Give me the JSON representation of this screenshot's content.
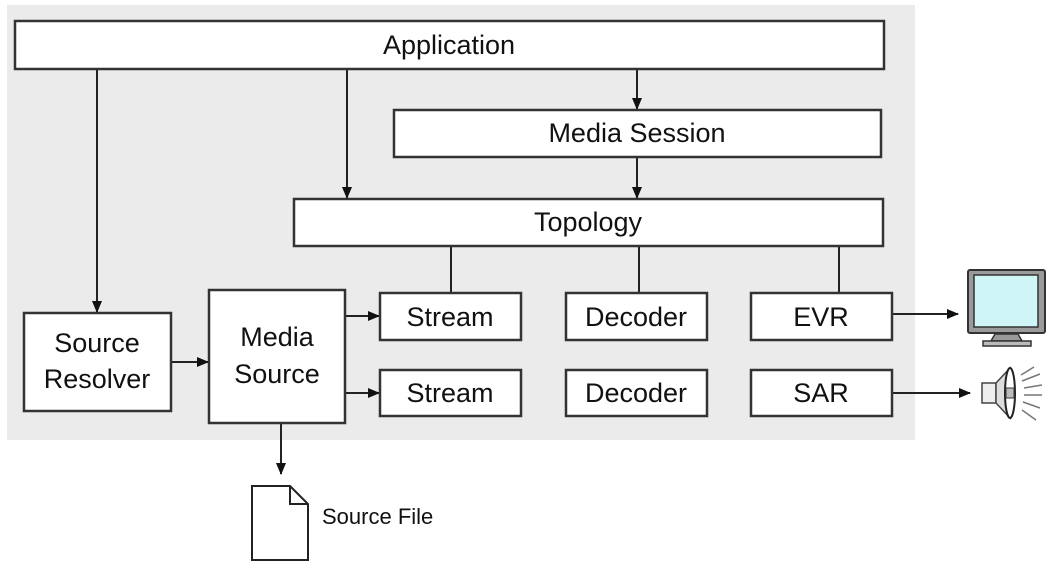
{
  "nodes": {
    "application": "Application",
    "media_session": "Media Session",
    "topology": "Topology",
    "source_resolver": [
      "Source",
      "Resolver"
    ],
    "media_source": [
      "Media",
      "Source"
    ],
    "stream_1": "Stream",
    "stream_2": "Stream",
    "decoder_1": "Decoder",
    "decoder_2": "Decoder",
    "evr": "EVR",
    "sar": "SAR",
    "source_file": "Source File"
  },
  "icons": [
    "monitor-icon",
    "speaker-icon",
    "document-icon"
  ],
  "colors": {
    "background_panel": "#ebebeb",
    "monitor_screen": "#cff5f7"
  }
}
